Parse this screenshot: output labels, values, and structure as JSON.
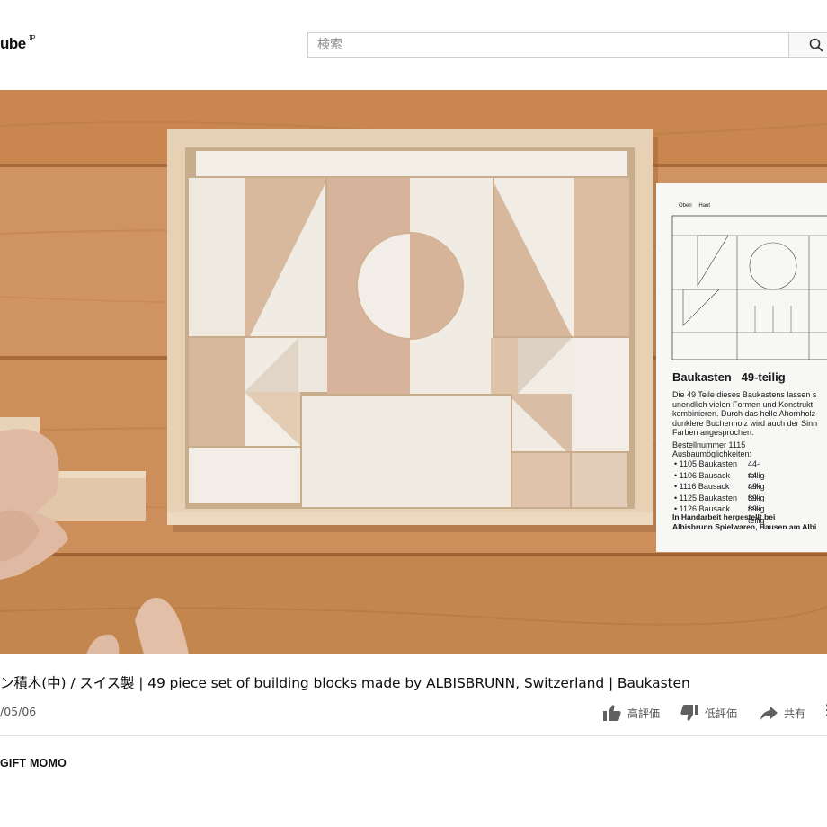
{
  "header": {
    "logo_text": "ube",
    "logo_region": "JP",
    "search_placeholder": "検索",
    "search_icon": "search-icon"
  },
  "video": {
    "card": {
      "top_label_left": "Oben",
      "top_label_right": "Haut",
      "heading": "Baukasten   49-teilig",
      "desc_lines": [
        "Die 49 Teile dieses Baukastens lassen s",
        "unendlich vielen Formen und Konstrukt",
        "kombinieren. Durch das helle Ahornholz",
        "dunklere Buchenholz wird auch der Sinn",
        "Farben angesprochen."
      ],
      "order_label": "Bestellnummer 1115",
      "expansion_label": "Ausbaumöglichkeiten:",
      "items": [
        {
          "code": "1105",
          "name": "Baukasten",
          "pieces": "44-teilig"
        },
        {
          "code": "1106",
          "name": "Bausack",
          "pieces": "44-teilig"
        },
        {
          "code": "1116",
          "name": "Bausack",
          "pieces": "49-teilig"
        },
        {
          "code": "1125",
          "name": "Baukasten",
          "pieces": "89-teilig"
        },
        {
          "code": "1126",
          "name": "Bausack",
          "pieces": "89-teilig"
        }
      ],
      "footer_lines": [
        "In Handarbeit hergestellt bei",
        "Albisbrunn Spielwaren, Hausen am Albi"
      ]
    }
  },
  "info": {
    "title": "ン積木(中) / スイス製 | 49 piece set of building blocks made by ALBISBRUNN, Switzerland | Baukasten",
    "date": "/05/06",
    "like_label": "高評価",
    "dislike_label": "低評価",
    "share_label": "共有",
    "more_label": "⋮",
    "channel_name": "GIFT MOMO"
  },
  "colors": {
    "accent_text": "#0f0f0f",
    "secondary_text": "#555555",
    "wood_table": "#c58650",
    "maple_block": "#efe7dc",
    "beech_block": "#d8b69a"
  }
}
